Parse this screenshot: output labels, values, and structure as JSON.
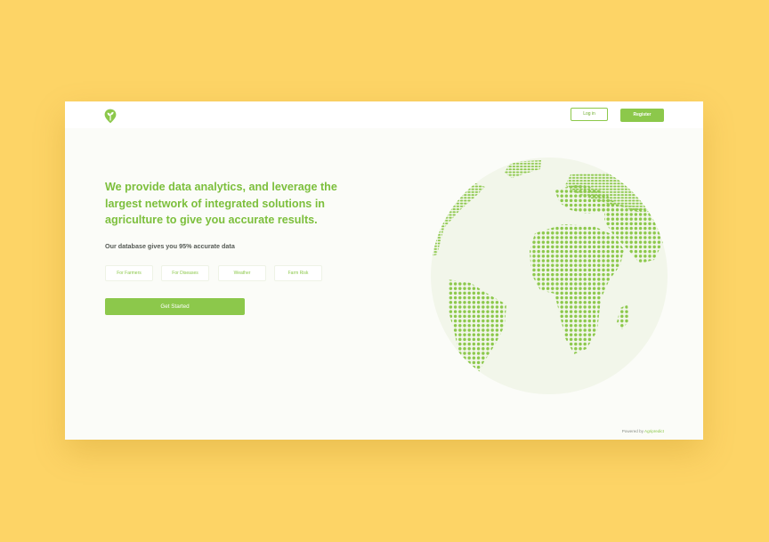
{
  "colors": {
    "background": "#fdd466",
    "accent": "#8cc84b",
    "headline": "#7cbf3c",
    "text_dark": "#555a55"
  },
  "header": {
    "logo_icon": "sprout-pin-icon",
    "login_label": "Log in",
    "register_label": "Register"
  },
  "hero": {
    "headline": "We provide data analytics, and leverage the largest network of integrated solutions in agriculture to give you accurate results.",
    "subheadline": "Our database gives you 95% accurate data",
    "chips": [
      "For Farmers",
      "For Diseases",
      "Weather",
      "Farm Risk"
    ],
    "cta_label": "Get Started"
  },
  "illustration": {
    "icon": "dotted-globe-icon"
  },
  "footer": {
    "powered_by": "Powered by",
    "brand": "Agripredict"
  }
}
